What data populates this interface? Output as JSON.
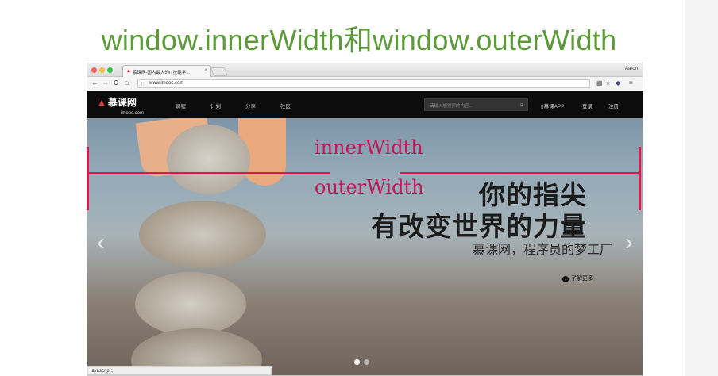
{
  "slide": {
    "title": "window.innerWidth和window.outerWidth"
  },
  "browser": {
    "tab_title": "慕课网-国内最大的IT技能学...",
    "tab_close": "×",
    "user": "Aaron",
    "url": "www.imooc.com",
    "status": "javascript:;"
  },
  "site": {
    "logo": "慕课网",
    "logo_sub": "imooc.com",
    "nav": [
      "课程",
      "计划",
      "分享",
      "社区"
    ],
    "search_placeholder": "请输入想搜索的内容...",
    "app_label": "慕课APP",
    "login": "登录",
    "register": "注册"
  },
  "hero": {
    "line1": "你的指尖",
    "line2": "有改变世界的力量",
    "subtitle": "慕课网，程序员的梦工厂",
    "more": "了解更多"
  },
  "annotations": {
    "inner": "innerWidth",
    "outer": "outerWidth",
    "color": "#d81b4d"
  },
  "icons": {
    "back": "←",
    "forward": "→",
    "reload": "C",
    "home": "⌂",
    "search": "⌕",
    "prev_arrow": "‹",
    "next_arrow": "›"
  }
}
